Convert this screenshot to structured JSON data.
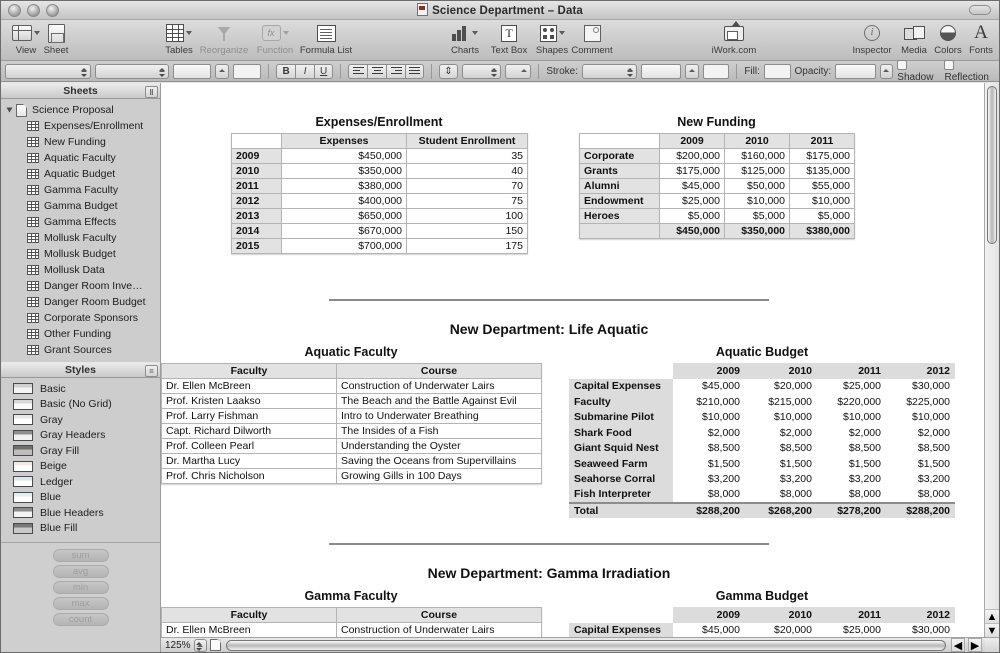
{
  "window": {
    "title": "Science Department – Data",
    "doc_icon": "numbers-document-icon"
  },
  "toolbar": {
    "items": [
      {
        "label": "View",
        "icon": "view-icon",
        "dim": false,
        "caret": true
      },
      {
        "label": "Sheet",
        "icon": "new-sheet-icon",
        "dim": false,
        "caret": false
      },
      {
        "label": "Tables",
        "icon": "tables-icon",
        "dim": false,
        "caret": true
      },
      {
        "label": "Reorganize",
        "icon": "reorganize-icon",
        "dim": true,
        "caret": false
      },
      {
        "label": "Function",
        "icon": "function-icon",
        "dim": true,
        "caret": true
      },
      {
        "label": "Formula List",
        "icon": "formula-list-icon",
        "dim": false,
        "caret": false
      },
      {
        "label": "Charts",
        "icon": "charts-icon",
        "dim": false,
        "caret": true
      },
      {
        "label": "Text Box",
        "icon": "text-box-icon",
        "dim": false,
        "caret": false
      },
      {
        "label": "Shapes",
        "icon": "shapes-icon",
        "dim": false,
        "caret": true
      },
      {
        "label": "Comment",
        "icon": "comment-icon",
        "dim": false,
        "caret": false
      },
      {
        "label": "iWork.com",
        "icon": "iwork-com-icon",
        "dim": false,
        "caret": false
      },
      {
        "label": "Inspector",
        "icon": "inspector-icon",
        "dim": false,
        "caret": false
      },
      {
        "label": "Media",
        "icon": "media-icon",
        "dim": false,
        "caret": false
      },
      {
        "label": "Colors",
        "icon": "colors-icon",
        "dim": false,
        "caret": false
      },
      {
        "label": "Fonts",
        "icon": "fonts-icon",
        "dim": false,
        "caret": false
      }
    ]
  },
  "format_bar": {
    "font_family_value": "",
    "font_style_value": "",
    "font_size_value": "",
    "text_color_value": "",
    "bold_label": "B",
    "italic_label": "I",
    "underline_label": "U",
    "stroke_label": "Stroke:",
    "stroke_value": "",
    "stroke_style_value": "",
    "stroke_color_value": "",
    "fill_label": "Fill:",
    "fill_value": "",
    "opacity_label": "Opacity:",
    "opacity_value": "",
    "shadow_label": "Shadow",
    "reflection_label": "Reflection"
  },
  "sidebar": {
    "sheets_pane_title": "Sheets",
    "styles_pane_title": "Styles",
    "sheets": [
      {
        "label": "Science Proposal",
        "type": "document"
      },
      {
        "label": "Expenses/Enrollment",
        "type": "table"
      },
      {
        "label": "New Funding",
        "type": "table"
      },
      {
        "label": "Aquatic Faculty",
        "type": "table"
      },
      {
        "label": "Aquatic Budget",
        "type": "table"
      },
      {
        "label": "Gamma Faculty",
        "type": "table"
      },
      {
        "label": "Gamma Budget",
        "type": "table"
      },
      {
        "label": "Gamma Effects",
        "type": "table"
      },
      {
        "label": "Mollusk Faculty",
        "type": "table"
      },
      {
        "label": "Mollusk Budget",
        "type": "table"
      },
      {
        "label": "Mollusk Data",
        "type": "table"
      },
      {
        "label": "Danger Room Inve…",
        "type": "table"
      },
      {
        "label": "Danger Room Budget",
        "type": "table"
      },
      {
        "label": "Corporate Sponsors",
        "type": "table"
      },
      {
        "label": "Other Funding",
        "type": "table"
      },
      {
        "label": "Grant Sources",
        "type": "table"
      }
    ],
    "styles": [
      {
        "label": "Basic",
        "swatch": "#f4f4f4",
        "header": "#cfcfcf"
      },
      {
        "label": "Basic (No Grid)",
        "swatch": "#fafafa",
        "header": "#d8d8d8"
      },
      {
        "label": "Gray",
        "swatch": "#ffffff",
        "header": "#e8e8e8"
      },
      {
        "label": "Gray Headers",
        "swatch": "#f2f2f2",
        "header": "#8e8e8e"
      },
      {
        "label": "Gray Fill",
        "swatch": "#bdbdbd",
        "header": "#6e6e6e"
      },
      {
        "label": "Beige",
        "swatch": "#ffffff",
        "header": "#f0ece2"
      },
      {
        "label": "Ledger",
        "swatch": "#ffffff",
        "header": "#dde6ef"
      },
      {
        "label": "Blue",
        "swatch": "#ffffff",
        "header": "#e4ecf6"
      },
      {
        "label": "Blue Headers",
        "swatch": "#f2f2f2",
        "header": "#8a8a8a"
      },
      {
        "label": "Blue Fill",
        "swatch": "#c9c9c9",
        "header": "#787878"
      }
    ],
    "functions": [
      "sum",
      "avg",
      "min",
      "max",
      "count"
    ]
  },
  "status_bar": {
    "zoom_value": "125%"
  },
  "document": {
    "tables": {
      "expenses_enrollment": {
        "title": "Expenses/Enrollment",
        "headers": [
          "",
          "Expenses",
          "Student Enrollment"
        ],
        "rows": [
          [
            "2009",
            "$450,000",
            "35"
          ],
          [
            "2010",
            "$350,000",
            "40"
          ],
          [
            "2011",
            "$380,000",
            "70"
          ],
          [
            "2012",
            "$400,000",
            "75"
          ],
          [
            "2013",
            "$650,000",
            "100"
          ],
          [
            "2014",
            "$670,000",
            "150"
          ],
          [
            "2015",
            "$700,000",
            "175"
          ]
        ]
      },
      "new_funding": {
        "title": "New Funding",
        "headers": [
          "",
          "2009",
          "2010",
          "2011"
        ],
        "rows": [
          [
            "Corporate",
            "$200,000",
            "$160,000",
            "$175,000"
          ],
          [
            "Grants",
            "$175,000",
            "$125,000",
            "$135,000"
          ],
          [
            "Alumni",
            "$45,000",
            "$50,000",
            "$55,000"
          ],
          [
            "Endowment",
            "$25,000",
            "$10,000",
            "$10,000"
          ],
          [
            "Heroes",
            "$5,000",
            "$5,000",
            "$5,000"
          ]
        ],
        "total_row": [
          "",
          "$450,000",
          "$350,000",
          "$380,000"
        ]
      },
      "aquatic_faculty": {
        "title": "Aquatic Faculty",
        "headers": [
          "Faculty",
          "Course"
        ],
        "rows": [
          [
            "Dr. Ellen McBreen",
            "Construction of Underwater Lairs"
          ],
          [
            "Prof. Kristen Laakso",
            "The Beach and the Battle Against Evil"
          ],
          [
            "Prof. Larry Fishman",
            "Intro to Underwater Breathing"
          ],
          [
            "Capt. Richard Dilworth",
            "The Insides of a Fish"
          ],
          [
            "Prof. Colleen Pearl",
            "Understanding the Oyster"
          ],
          [
            "Dr. Martha Lucy",
            "Saving the Oceans from Supervillains"
          ],
          [
            "Prof. Chris Nicholson",
            "Growing Gills in 100 Days"
          ]
        ]
      },
      "aquatic_budget": {
        "title": "Aquatic Budget",
        "headers": [
          "",
          "2009",
          "2010",
          "2011",
          "2012"
        ],
        "rows": [
          [
            "Capital Expenses",
            "$45,000",
            "$20,000",
            "$25,000",
            "$30,000"
          ],
          [
            "Faculty",
            "$210,000",
            "$215,000",
            "$220,000",
            "$225,000"
          ],
          [
            "Submarine Pilot",
            "$10,000",
            "$10,000",
            "$10,000",
            "$10,000"
          ],
          [
            "Shark Food",
            "$2,000",
            "$2,000",
            "$2,000",
            "$2,000"
          ],
          [
            "Giant Squid Nest",
            "$8,500",
            "$8,500",
            "$8,500",
            "$8,500"
          ],
          [
            "Seaweed Farm",
            "$1,500",
            "$1,500",
            "$1,500",
            "$1,500"
          ],
          [
            "Seahorse Corral",
            "$3,200",
            "$3,200",
            "$3,200",
            "$3,200"
          ],
          [
            "Fish Interpreter",
            "$8,000",
            "$8,000",
            "$8,000",
            "$8,000"
          ]
        ],
        "total_row": [
          "Total",
          "$288,200",
          "$268,200",
          "$278,200",
          "$288,200"
        ]
      },
      "gamma_faculty": {
        "title": "Gamma Faculty",
        "headers": [
          "Faculty",
          "Course"
        ],
        "rows": [
          [
            "Dr. Ellen McBreen",
            "Construction of Underwater Lairs"
          ]
        ]
      },
      "gamma_budget": {
        "title": "Gamma Budget",
        "headers": [
          "",
          "2009",
          "2010",
          "2011",
          "2012"
        ],
        "rows": [
          [
            "Capital Expenses",
            "$45,000",
            "$20,000",
            "$25,000",
            "$30,000"
          ]
        ]
      }
    },
    "section_headings": [
      "New Department: Life Aquatic",
      "New Department: Gamma Irradiation"
    ]
  }
}
